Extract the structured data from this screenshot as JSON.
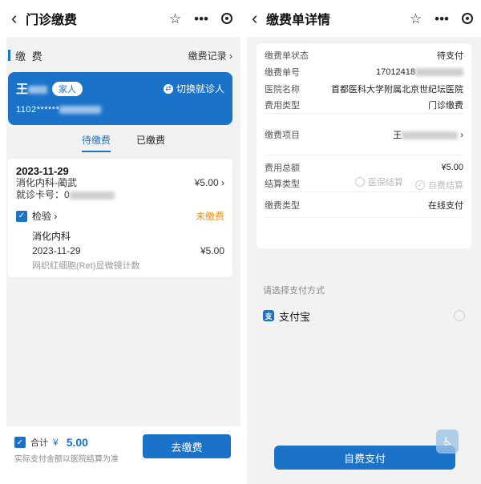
{
  "left": {
    "nav": {
      "back": "‹",
      "title": "门诊缴费"
    },
    "section": {
      "title": "缴 费",
      "record": "缴费记录 ›"
    },
    "patient": {
      "name": "王",
      "tag": "家人",
      "switch": "切换就诊人",
      "id_card": "1102******"
    },
    "tabs": [
      {
        "label": "待缴费"
      },
      {
        "label": "已缴费"
      }
    ],
    "bill": {
      "date": "2023-11-29",
      "dept_doctor": "消化内科-蔺武",
      "amount": "¥5.00",
      "card_label": "就诊卡号：0",
      "item_label": "检验",
      "status": "未缴费",
      "sub_dept": "消化内科",
      "sub_date": "2023-11-29",
      "sub_amount": "¥5.00",
      "sub_desc": "网织红细胞(Ret)显微镜计数"
    },
    "bottom": {
      "total_label": "合计",
      "yen": "¥",
      "total_value": "5.00",
      "note": "实际支付金额以医院结算为准",
      "pay_button": "去缴费"
    }
  },
  "right": {
    "nav": {
      "back": "‹",
      "title": "缴费单详情"
    },
    "rows": {
      "status_label": "缴费单状态",
      "status_value": "待支付",
      "number_label": "缴费单号",
      "number_value": "17012418",
      "hospital_label": "医院名称",
      "hospital_value": "首都医科大学附属北京世纪坛医院",
      "fee_type_label": "费用类型",
      "fee_type_value": "门诊缴费",
      "item_label": "缴费项目",
      "item_value": "王",
      "total_label": "费用总额",
      "total_value": "¥5.00",
      "settle_label": "结算类型",
      "settle_opt1": "医保结算",
      "settle_opt2": "自费结算",
      "pay_type_label": "缴费类型",
      "pay_type_value": "在线支付"
    },
    "pay_method_label": "请选择支付方式",
    "alipay": {
      "icon": "支",
      "name": "支付宝"
    },
    "self_pay_button": "自费支付"
  }
}
